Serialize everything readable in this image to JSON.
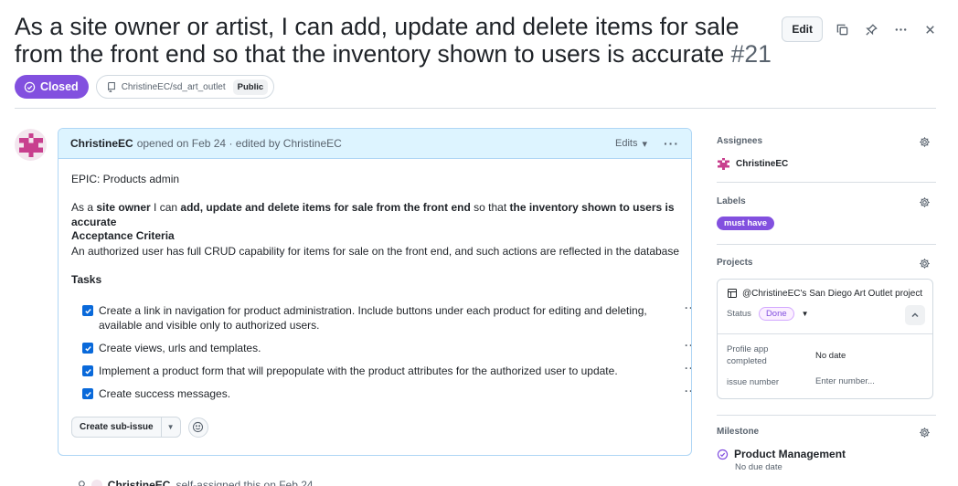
{
  "issue": {
    "title": "As a site owner or artist, I can add, update and delete items for sale from the front end so that the inventory shown to users is accurate",
    "number": "#21",
    "state": "Closed",
    "repo": "ChristineEC/sd_art_outlet",
    "visibility": "Public"
  },
  "header_actions": {
    "edit_label": "Edit",
    "icons": [
      "copy-icon",
      "pin-icon",
      "kebab-icon",
      "close-icon"
    ]
  },
  "comment": {
    "author": "ChristineEC",
    "meta": "opened on Feb 24 · edited by ChristineEC",
    "edits_label": "Edits",
    "epic": "EPIC: Products admin",
    "story": {
      "p1": "As a ",
      "b1": "site owner",
      "p2": " I can ",
      "b2": "add, update and delete items for sale from the front end",
      "p3": " so that ",
      "b3": "the inventory shown to users is accurate"
    },
    "acceptance_title": "Acceptance Criteria",
    "acceptance_text": "An authorized user has full CRUD capability for items for sale on the front end, and such actions are reflected in the database",
    "tasks_title": "Tasks",
    "tasks": [
      {
        "text": "Create a link in navigation for product administration. Include buttons under each product for editing and deleting, available and visible only to authorized users.",
        "checked": true
      },
      {
        "text": "Create views, urls and templates.",
        "checked": true
      },
      {
        "text": "Implement a product form that will prepopulate with the product attributes for the authorized user to update.",
        "checked": true
      },
      {
        "text": "Create success messages.",
        "checked": true
      }
    ],
    "create_sub_issue_label": "Create sub-issue"
  },
  "timeline": {
    "actor": "ChristineEC",
    "event": "self-assigned this on Feb 24"
  },
  "sidebar": {
    "assignees_heading": "Assignees",
    "assignee": "ChristineEC",
    "labels_heading": "Labels",
    "label": "must have",
    "label_color": "#8250df",
    "projects_heading": "Projects",
    "project": {
      "title": "@ChristineEC's San Diego Art Outlet project",
      "status_label": "Status",
      "status_value": "Done",
      "fields": [
        {
          "label": "Profile app completed",
          "value": "No date"
        },
        {
          "label": "issue number",
          "value": "Enter number..."
        }
      ]
    },
    "milestone_heading": "Milestone",
    "milestone": "Product Management",
    "milestone_due": "No due date"
  },
  "colors": {
    "closed": "#8250df",
    "accent": "#0969da",
    "comment_header": "#ddf4ff"
  }
}
